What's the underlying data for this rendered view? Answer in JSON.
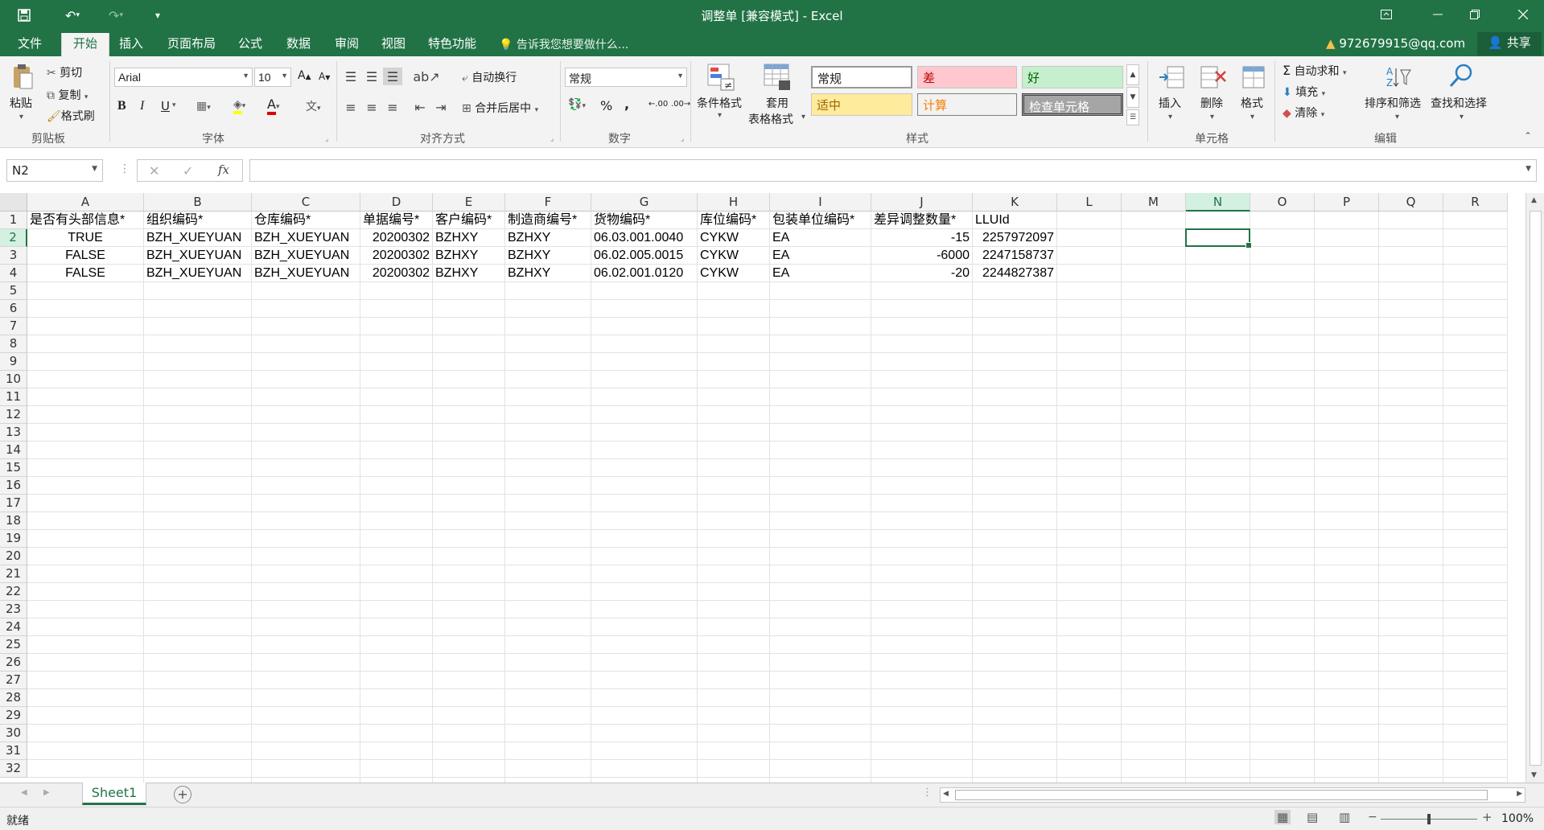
{
  "titlebar": {
    "title": "调整单  [兼容模式] - Excel",
    "save_icon": "save-icon",
    "undo_icon": "undo-icon",
    "redo_icon": "redo-icon"
  },
  "tabs": {
    "items": [
      "文件",
      "开始",
      "插入",
      "页面布局",
      "公式",
      "数据",
      "审阅",
      "视图",
      "特色功能"
    ],
    "active": "开始",
    "tell_me": "告诉我您想要做什么...",
    "account": "972679915@qq.com",
    "share": "共享"
  },
  "ribbon": {
    "clipboard": {
      "paste": "粘贴",
      "cut": "剪切",
      "copy": "复制",
      "format_painter": "格式刷",
      "label": "剪贴板"
    },
    "font": {
      "name": "Arial",
      "size": "10",
      "bold": "B",
      "italic": "I",
      "underline": "U",
      "font_color": "A",
      "label": "字体"
    },
    "alignment": {
      "wrap": "自动换行",
      "merge": "合并后居中",
      "label": "对齐方式"
    },
    "number": {
      "format": "常规",
      "percent": "%",
      "comma": ",",
      "label": "数字"
    },
    "styles": {
      "conditional": "条件格式",
      "table1": "套用",
      "table2": "表格格式",
      "normal": "常规",
      "bad": "差",
      "good": "好",
      "neutral": "适中",
      "calc": "计算",
      "check": "检查单元格",
      "label": "样式"
    },
    "cells": {
      "insert": "插入",
      "delete": "删除",
      "format": "格式",
      "label": "单元格"
    },
    "editing": {
      "autosum": "自动求和",
      "fill": "填充",
      "clear": "清除",
      "sort": "排序和筛选",
      "find": "查找和选择",
      "label": "编辑"
    }
  },
  "formula_bar": {
    "name_box": "N2",
    "fx": "fx",
    "value": ""
  },
  "grid": {
    "columns": [
      "A",
      "B",
      "C",
      "D",
      "E",
      "F",
      "G",
      "H",
      "I",
      "J",
      "K",
      "L",
      "M",
      "N",
      "O",
      "P",
      "Q",
      "R"
    ],
    "selected_column": "N",
    "selected_row": 2,
    "rows_visible": 32,
    "cells": [
      [
        "是否有头部信息*",
        "组织编码*",
        "仓库编码*",
        "单据编号*",
        "客户编码*",
        "制造商编号*",
        "货物编码*",
        "库位编码*",
        "包装单位编码*",
        "差异调整数量*",
        "LLUId"
      ],
      [
        "TRUE",
        "BZH_XUEYUAN",
        "BZH_XUEYUAN",
        "20200302",
        "BZHXY",
        "BZHXY",
        "06.03.001.0040",
        "CYKW",
        "EA",
        "-15",
        "2257972097"
      ],
      [
        "FALSE",
        "BZH_XUEYUAN",
        "BZH_XUEYUAN",
        "20200302",
        "BZHXY",
        "BZHXY",
        "06.02.005.0015",
        "CYKW",
        "EA",
        "-6000",
        "2247158737"
      ],
      [
        "FALSE",
        "BZH_XUEYUAN",
        "BZH_XUEYUAN",
        "20200302",
        "BZHXY",
        "BZHXY",
        "06.02.001.0120",
        "CYKW",
        "EA",
        "-20",
        "2244827387"
      ]
    ]
  },
  "sheets": {
    "active": "Sheet1"
  },
  "status": {
    "text": "就绪",
    "zoom": "100%"
  },
  "colors": {
    "accent": "#217346"
  }
}
